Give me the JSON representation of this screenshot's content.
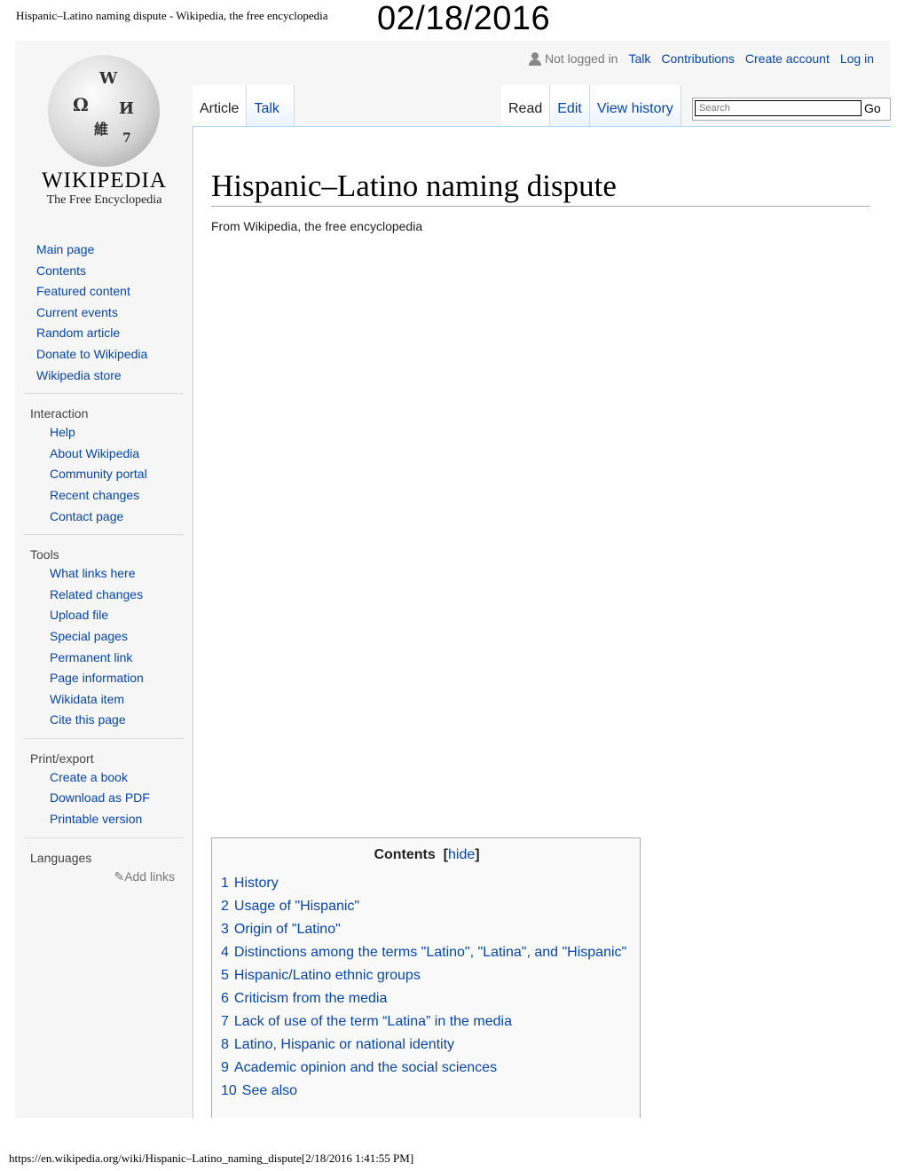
{
  "print_header": {
    "title": "Hispanic–Latino naming dispute - Wikipedia, the free encyclopedia",
    "date": "02/18/2016"
  },
  "print_footer": {
    "url": "https://en.wikipedia.org/wiki/Hispanic–Latino_naming_dispute[2/18/2016 1:41:55 PM]"
  },
  "personal": {
    "not_logged_in": "Not logged in",
    "talk": "Talk",
    "contributions": "Contributions",
    "create_account": "Create account",
    "log_in": "Log in"
  },
  "logo": {
    "wordmark": "WIKIPEDIA",
    "tagline": "The Free Encyclopedia"
  },
  "tabs": {
    "article": "Article",
    "talk": "Talk",
    "read": "Read",
    "edit": "Edit",
    "view_history": "View history"
  },
  "search": {
    "placeholder": "Search",
    "go": "Go"
  },
  "sidebar": {
    "main": [
      "Main page",
      "Contents",
      "Featured content",
      "Current events",
      "Random article",
      "Donate to Wikipedia",
      "Wikipedia store"
    ],
    "interaction_heading": "Interaction",
    "interaction": [
      "Help",
      "About Wikipedia",
      "Community portal",
      "Recent changes",
      "Contact page"
    ],
    "tools_heading": "Tools",
    "tools": [
      "What links here",
      "Related changes",
      "Upload file",
      "Special pages",
      "Permanent link",
      "Page information",
      "Wikidata item",
      "Cite this page"
    ],
    "print_heading": "Print/export",
    "print": [
      "Create a book",
      "Download as PDF",
      "Printable version"
    ],
    "languages_heading": "Languages",
    "add_links": "Add links"
  },
  "article": {
    "title": "Hispanic–Latino naming dispute",
    "subtitle": "From Wikipedia, the free encyclopedia"
  },
  "toc": {
    "heading": "Contents",
    "hide": "hide",
    "items": [
      {
        "num": "1",
        "label": "History"
      },
      {
        "num": "2",
        "label": "Usage of \"Hispanic\""
      },
      {
        "num": "3",
        "label": "Origin of \"Latino\""
      },
      {
        "num": "4",
        "label": "Distinctions among the terms \"Latino\", \"Latina\", and \"Hispanic\""
      },
      {
        "num": "5",
        "label": "Hispanic/Latino ethnic groups"
      },
      {
        "num": "6",
        "label": "Criticism from the media"
      },
      {
        "num": "7",
        "label": "Lack of use of the term “Latina” in the media"
      },
      {
        "num": "8",
        "label": "Latino, Hispanic or national identity"
      },
      {
        "num": "9",
        "label": "Academic opinion and the social sciences"
      },
      {
        "num": "10",
        "label": "See also"
      }
    ]
  },
  "colors": {
    "link": "#0645ad",
    "border": "#a7d7f9",
    "sidebar_bg": "#f6f6f6"
  }
}
